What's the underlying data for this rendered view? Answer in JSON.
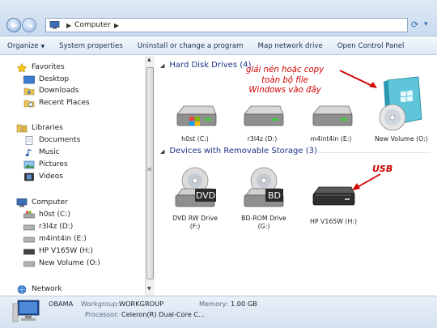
{
  "address_bar": {
    "path": [
      "Computer"
    ],
    "back_icon": "back-arrow-icon",
    "forward_icon": "forward-arrow-icon"
  },
  "toolbar": {
    "organize": "Organize",
    "system_properties": "System properties",
    "uninstall": "Uninstall or change a program",
    "map_drive": "Map network drive",
    "control_panel": "Open Control Panel"
  },
  "sidebar": {
    "favorites": {
      "label": "Favorites",
      "items": [
        "Desktop",
        "Downloads",
        "Recent Places"
      ]
    },
    "libraries": {
      "label": "Libraries",
      "items": [
        "Documents",
        "Music",
        "Pictures",
        "Videos"
      ]
    },
    "computer": {
      "label": "Computer",
      "items": [
        "h0st (C:)",
        "r3l4z (D:)",
        "m4int4in (E:)",
        "HP V165W (H:)",
        "New Volume (O:)"
      ]
    },
    "network": {
      "label": "Network"
    }
  },
  "main": {
    "hard_disks": {
      "title": "Hard Disk Drives (4)",
      "drives": [
        "h0st (C:)",
        "r3l4z (D:)",
        "m4int4in (E:)",
        "New Volume (O:)"
      ]
    },
    "removable": {
      "title": "Devices with Removable Storage (3)",
      "devices": [
        {
          "line1": "DVD RW Drive",
          "line2": "(F:)",
          "badge": "DVD"
        },
        {
          "line1": "BD-ROM Drive",
          "line2": "(G:)",
          "badge": "BD"
        },
        {
          "line1": "HP V165W (H:)",
          "line2": "",
          "badge": ""
        }
      ]
    }
  },
  "annotations": {
    "copy_note": [
      "giải nén hoặc copy",
      "toàn bộ file",
      "Windows vào đây"
    ],
    "usb": "USB",
    "color": "#d10000"
  },
  "status": {
    "computer_name": "OBAMA",
    "workgroup_key": "Workgroup:",
    "workgroup_val": "WORKGROUP",
    "memory_key": "Memory:",
    "memory_val": "1.00 GB",
    "processor_key": "Processor:",
    "processor_val": "Celeron(R) Dual-Core C..."
  }
}
